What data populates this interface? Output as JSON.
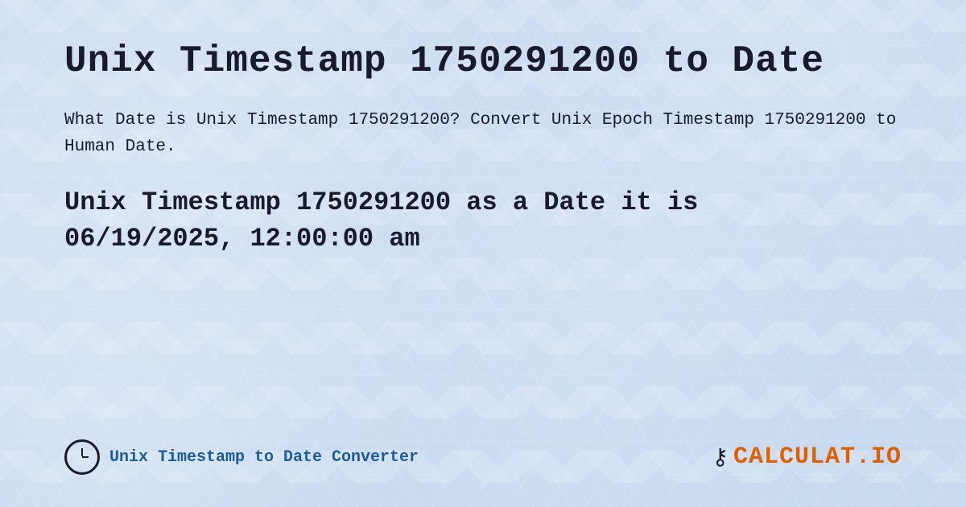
{
  "page": {
    "title": "Unix Timestamp 1750291200 to Date",
    "description": "What Date is Unix Timestamp 1750291200? Convert Unix Epoch Timestamp 1750291200 to Human Date.",
    "result_line1": "Unix Timestamp 1750291200 as a Date it is",
    "result_line2": "06/19/2025, 12:00:00 am",
    "footer": {
      "converter_label": "Unix Timestamp to Date Converter",
      "logo_text_main": "CALCULAT",
      "logo_text_accent": ".IO"
    }
  }
}
